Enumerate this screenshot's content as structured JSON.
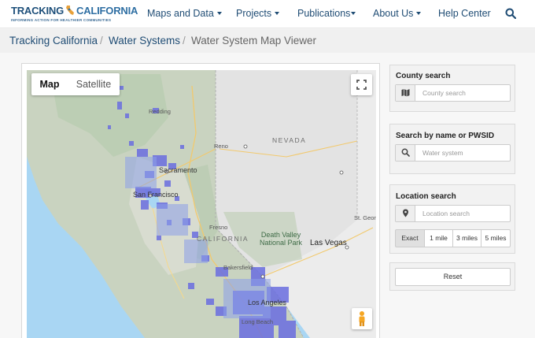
{
  "logo": {
    "tracking": "TRACKING",
    "california": "CALIFORNIA",
    "tagline": "INFORMING ACTION FOR HEALTHIER COMMUNITIES"
  },
  "nav": {
    "items": [
      {
        "label": "Maps and Data",
        "dropdown": true
      },
      {
        "label": "Projects",
        "dropdown": true
      },
      {
        "label": "Publications",
        "dropdown": true
      },
      {
        "label": "About Us",
        "dropdown": true
      },
      {
        "label": "Help Center",
        "dropdown": false
      }
    ],
    "search_icon": "search-icon"
  },
  "breadcrumb": {
    "items": [
      "Tracking California",
      "Water Systems",
      "Water System Map Viewer"
    ],
    "separator": "/"
  },
  "map": {
    "type_control": {
      "map": "Map",
      "satellite": "Satellite",
      "selected": "Map"
    },
    "labels": {
      "redding": "Redding",
      "reno": "Reno",
      "nevada": "NEVADA",
      "sacramento": "Sacramento",
      "san_francisco": "San Francisco",
      "fresno": "Fresno",
      "california": "CALIFORNIA",
      "death_valley": "Death Valley\nNational Park",
      "las_vegas": "Las Vegas",
      "st_george": "St. George",
      "bakersfield": "Bakersfield",
      "los_angeles": "Los Angeles",
      "long_beach": "Long Beach"
    },
    "colors": {
      "ocean": "#a9d6f3",
      "land_ca": "#c9d7c3",
      "land_other": "#e6e6e6",
      "water_systems": "#6a6ee0"
    }
  },
  "county_search": {
    "title": "County search",
    "placeholder": "County search",
    "icon": "map-icon"
  },
  "name_search": {
    "title": "Search by name or PWSID",
    "placeholder": "Water system",
    "icon": "search-icon"
  },
  "location_search": {
    "title": "Location search",
    "placeholder": "Location search",
    "icon": "map-marker-icon",
    "distances": [
      "Exact",
      "1 mile",
      "3 miles",
      "5 miles"
    ],
    "selected": "Exact"
  },
  "reset": {
    "label": "Reset"
  }
}
